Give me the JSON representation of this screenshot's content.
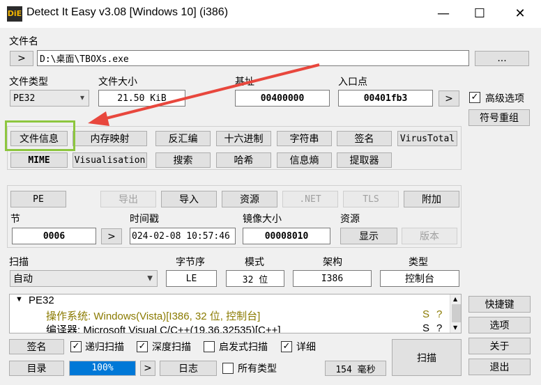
{
  "window": {
    "title": "Detect It Easy v3.08 [Windows 10] (i386)",
    "icon_text": "DiE",
    "minimize": "—",
    "maximize": "☐",
    "close": "✕"
  },
  "file": {
    "label": "文件名",
    "arrow_btn": ">",
    "path": "D:\\桌面\\TBOXs.exe",
    "browse_btn": "..."
  },
  "info": {
    "type_label": "文件类型",
    "type_value": "PE32",
    "size_label": "文件大小",
    "size_value": "21.50 KiB",
    "base_label": "基址",
    "base_value": "00400000",
    "entry_label": "入口点",
    "entry_value": "00401fb3",
    "entry_btn": ">",
    "advanced_label": "高级选项",
    "advanced_checked": "✓",
    "symbols_btn": "符号重组"
  },
  "tools": {
    "row1": [
      "文件信息",
      "内存映射",
      "反汇编",
      "十六进制",
      "字符串",
      "签名",
      "VirusTotal"
    ],
    "row2": [
      "MIME",
      "Visualisation",
      "搜索",
      "哈希",
      "信息熵",
      "提取器"
    ]
  },
  "pe": {
    "tabs": [
      "PE",
      "导出",
      "导入",
      "资源",
      ".NET",
      "TLS",
      "附加"
    ],
    "section_label": "节",
    "section_value": "0006",
    "section_btn": ">",
    "timestamp_label": "时间戳",
    "timestamp_value": "024-02-08 10:57:46",
    "image_size_label": "镜像大小",
    "image_size_value": "00008010",
    "resource_label": "资源",
    "show_btn": "显示",
    "version_btn": "版本"
  },
  "scan": {
    "scan_label": "扫描",
    "scan_mode": "自动",
    "endian_label": "字节序",
    "endian_value": "LE",
    "mode_label": "模式",
    "mode_value": "32 位",
    "arch_label": "架构",
    "arch_value": "I386",
    "type_label": "类型",
    "type_value": "控制台"
  },
  "results": {
    "root": "PE32",
    "rows": [
      {
        "text": "操作系统: Windows(Vista)[I386, 32 位, 控制台]",
        "flag": "S",
        "q": "?"
      },
      {
        "text": "编译器: Microsoft Visual C/C++(19.36.32535)[C++]",
        "flag": "S",
        "q": "?"
      }
    ]
  },
  "sidebar": {
    "hotkeys": "快捷键",
    "options": "选项",
    "about": "关于",
    "exit": "退出"
  },
  "bottom": {
    "signature_btn": "签名",
    "recursive": "递归扫描",
    "deep": "深度扫描",
    "heuristic": "启发式扫描",
    "verbose": "详细",
    "directory_btn": "目录",
    "progress": "100%",
    "progress_value": 1.0,
    "progress_arrow": ">",
    "log_btn": "日志",
    "all_types": "所有类型",
    "elapsed": "154 毫秒",
    "scan_btn": "扫描",
    "check": "✓"
  },
  "colors": {
    "highlight_box": "#8dc63f",
    "annotation_arrow": "#e8473d",
    "progress_fill": "#0078d7",
    "result_text_olive": "#8a7a00"
  }
}
